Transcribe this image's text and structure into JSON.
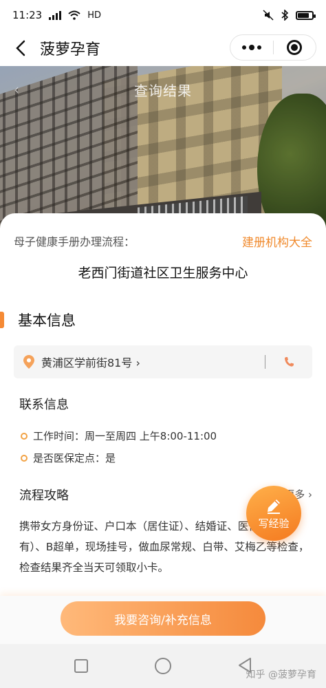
{
  "status": {
    "time": "11:23",
    "network": "HD",
    "battery_level": 0.8
  },
  "nav": {
    "title": "菠萝孕育"
  },
  "hero": {
    "title": "查询结果"
  },
  "card": {
    "process_label": "母子健康手册办理流程：",
    "org_link": "建册机构大全",
    "center_name": "老西门街道社区卫生服务中心"
  },
  "basic": {
    "section_title": "基本信息",
    "address": "黄浦区学前街81号 ›",
    "contact_title": "联系信息",
    "work_time": "工作时间：周一至周四 上午8:00-11:00",
    "insurance": "是否医保定点：是"
  },
  "guide": {
    "title": "流程攻略",
    "more": "查看更多 ›",
    "body": "携带女方身份证、户口本（居住证）、结婚证、医保卡（如有）、B超单，现场挂号，做血尿常规、白带、艾梅乙等检查，检查结果齐全当天可领取小卡。"
  },
  "fab": {
    "label": "写经验"
  },
  "action": {
    "consult": "我要咨询/补充信息"
  },
  "watermark": "知乎 @菠萝孕育",
  "colors": {
    "accent": "#f58a35",
    "link": "#f08a2d"
  }
}
